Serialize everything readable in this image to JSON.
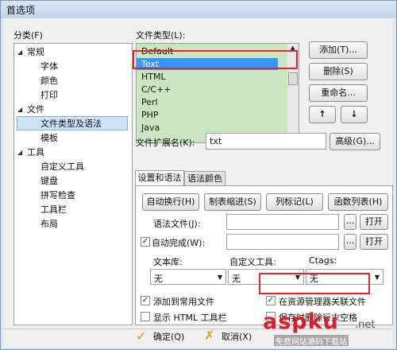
{
  "window": {
    "title": "首选项"
  },
  "categories": {
    "label": "分类(F)",
    "items": [
      {
        "label": "常规",
        "level": 0,
        "expanded": true
      },
      {
        "label": "字体",
        "level": 1
      },
      {
        "label": "颜色",
        "level": 1
      },
      {
        "label": "打印",
        "level": 1
      },
      {
        "label": "文件",
        "level": 0,
        "expanded": true
      },
      {
        "label": "文件类型及语法",
        "level": 1,
        "selected": true
      },
      {
        "label": "模板",
        "level": 1
      },
      {
        "label": "工具",
        "level": 0,
        "expanded": true
      },
      {
        "label": "自定义工具",
        "level": 1
      },
      {
        "label": "键盘",
        "level": 1
      },
      {
        "label": "拼写检查",
        "level": 1
      },
      {
        "label": "工具栏",
        "level": 1
      },
      {
        "label": "布局",
        "level": 1
      }
    ]
  },
  "file_types": {
    "label": "文件类型(L):",
    "items": [
      "Default",
      "Text",
      "HTML",
      "C/C++",
      "Perl",
      "PHP",
      "Java"
    ],
    "selected": "Text",
    "buttons": {
      "add": "添加(T)...",
      "delete": "删除(S)",
      "rename": "重命名...",
      "up": "↑",
      "down": "↓"
    }
  },
  "extension": {
    "label": "文件扩展名(K):",
    "value": "txt",
    "advanced": "高级(G)..."
  },
  "tabs": [
    {
      "label": "设置和语法",
      "active": true
    },
    {
      "label": "语法颜色",
      "active": false
    }
  ],
  "settings": {
    "buttons": [
      "自动换行(H)",
      "制表缩进(S)",
      "列标记(L)",
      "函数列表(H)"
    ],
    "syntax_file": {
      "label": "语法文件(J):",
      "value": "",
      "browse": "...",
      "open": "打开"
    },
    "autocomplete": {
      "label": "自动完成(W):",
      "checked": true,
      "value": "",
      "browse": "...",
      "open": "打开"
    },
    "libraries": {
      "text_lib_label": "文本库:",
      "text_lib_value": "无",
      "custom_tool_label": "自定义工具:",
      "custom_tool_value": "无",
      "ctags_label": "Ctags:",
      "ctags_value": "无"
    },
    "checks": [
      {
        "label": "添加到常用文件",
        "checked": true
      },
      {
        "label": "在资源管理器关联文件",
        "checked": true
      },
      {
        "label": "显示 HTML 工具栏",
        "checked": false
      },
      {
        "label": "保存时删除行末空格",
        "checked": false
      }
    ]
  },
  "footer": {
    "ok": "确定(Q)",
    "cancel": "取消(X)"
  },
  "watermark": {
    "brand": "aspku",
    "suffix": ".net",
    "sub": "免费网站源码下载站"
  },
  "colors": {
    "highlight": "#e0262c",
    "selection": "#3399ff",
    "list_bg": "#c9e6c0"
  }
}
